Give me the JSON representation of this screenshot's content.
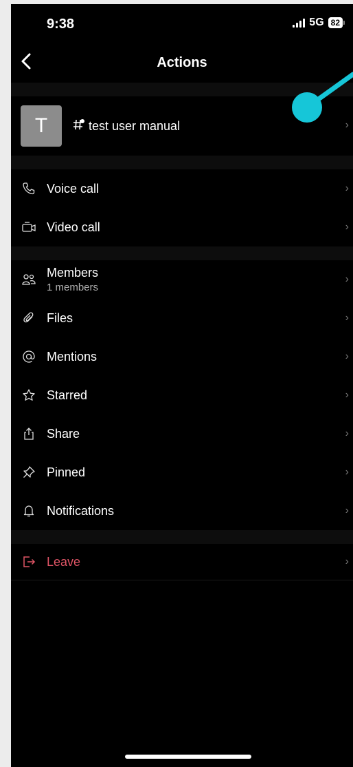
{
  "status_bar": {
    "time": "9:38",
    "network": "5G",
    "battery": "82"
  },
  "nav": {
    "title": "Actions"
  },
  "channel": {
    "avatar_letter": "T",
    "name": "test user manual"
  },
  "rows": {
    "voice_call": "Voice call",
    "video_call": "Video call",
    "members": "Members",
    "members_sub": "1 members",
    "files": "Files",
    "mentions": "Mentions",
    "starred": "Starred",
    "share": "Share",
    "pinned": "Pinned",
    "notifications": "Notifications",
    "leave": "Leave"
  },
  "chevron": "›",
  "colors": {
    "background": "#000000",
    "leave": "#e05566",
    "annotation": "#16c6d8"
  }
}
